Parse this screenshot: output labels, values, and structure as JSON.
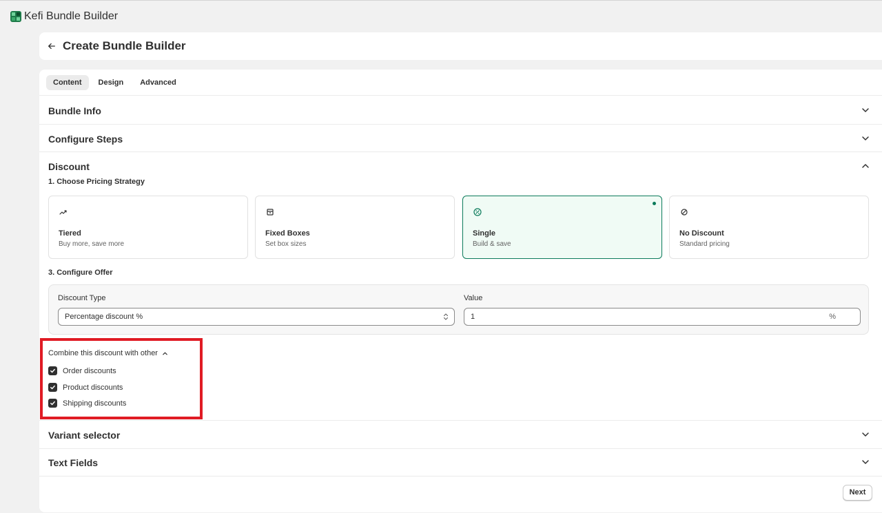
{
  "app": {
    "title": "Kefi Bundle Builder",
    "logo_icon": "kefi-logo-icon"
  },
  "header": {
    "title": "Create Bundle Builder"
  },
  "tabs": [
    {
      "label": "Content",
      "active": true
    },
    {
      "label": "Design",
      "active": false
    },
    {
      "label": "Advanced",
      "active": false
    }
  ],
  "sections": {
    "bundle_info": {
      "title": "Bundle Info",
      "expanded": false
    },
    "configure_steps": {
      "title": "Configure Steps",
      "expanded": false
    },
    "discount": {
      "title": "Discount",
      "expanded": true
    },
    "variant_selector": {
      "title": "Variant selector",
      "expanded": false
    },
    "text_fields": {
      "title": "Text Fields",
      "expanded": false
    }
  },
  "discount": {
    "pricing_heading": "1. Choose Pricing Strategy",
    "strategies": [
      {
        "title": "Tiered",
        "subtitle": "Buy more, save more",
        "icon": "trending-up-icon",
        "selected": false
      },
      {
        "title": "Fixed Boxes",
        "subtitle": "Set box sizes",
        "icon": "box-icon",
        "selected": false
      },
      {
        "title": "Single",
        "subtitle": "Build & save",
        "icon": "discount-badge-icon",
        "selected": true
      },
      {
        "title": "No Discount",
        "subtitle": "Standard pricing",
        "icon": "no-entry-icon",
        "selected": false
      }
    ],
    "offer_heading": "3. Configure Offer",
    "discount_type_label": "Discount Type",
    "discount_type_value": "Percentage discount %",
    "value_label": "Value",
    "value": "1",
    "value_suffix": "%",
    "combine_label": "Combine this discount with other",
    "combine_options": [
      {
        "label": "Order discounts",
        "checked": true
      },
      {
        "label": "Product discounts",
        "checked": true
      },
      {
        "label": "Shipping discounts",
        "checked": true
      }
    ]
  },
  "footer": {
    "next_label": "Next"
  },
  "colors": {
    "accent": "#0a7a5a",
    "selected_bg": "#f0fbf5",
    "highlight": "#e01b24"
  }
}
